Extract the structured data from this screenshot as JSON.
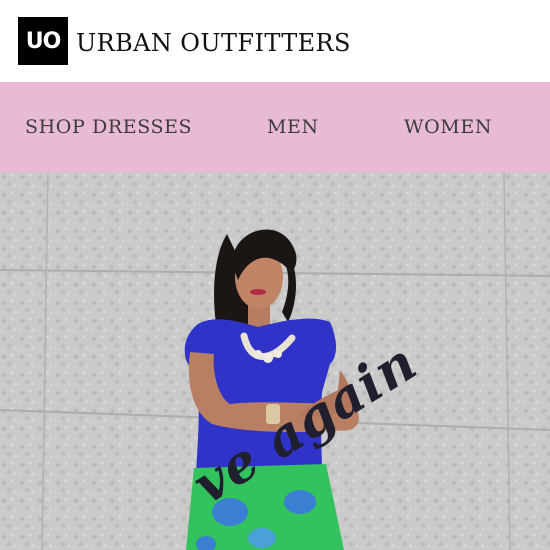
{
  "header": {
    "logo_mark": "UO",
    "brand_name": "URBAN OUTFITTERS"
  },
  "nav": {
    "items": [
      {
        "label": "SHOP DRESSES"
      },
      {
        "label": "MEN"
      },
      {
        "label": "WOMEN"
      }
    ],
    "background": "#e8bad4"
  },
  "hero": {
    "overlay_text": "ve again"
  }
}
